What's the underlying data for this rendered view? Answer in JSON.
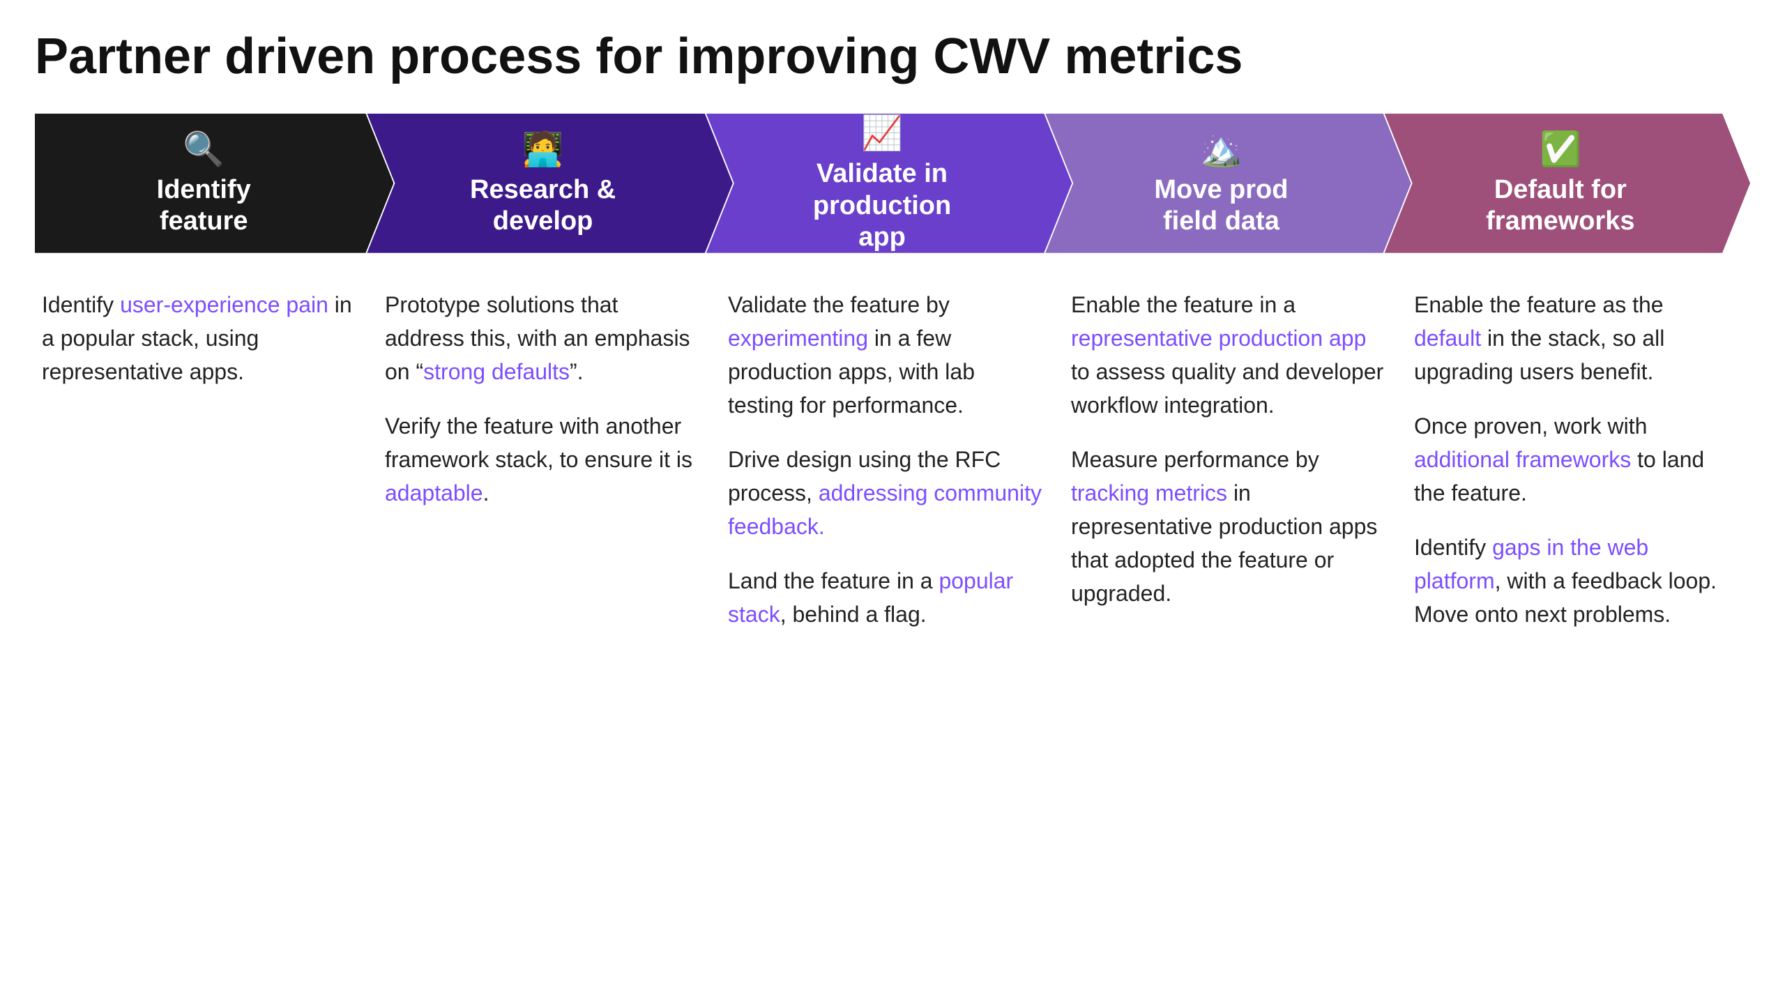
{
  "page": {
    "title": "Partner driven process for improving CWV metrics"
  },
  "arrows": [
    {
      "id": "identify",
      "icon": "🔍",
      "title": "Identify\nfeature",
      "bg": "#1a1a1a"
    },
    {
      "id": "research",
      "icon": "🧑‍💻",
      "title": "Research &\ndevelop",
      "bg": "#3d1a8a"
    },
    {
      "id": "validate",
      "icon": "📈",
      "title": "Validate in\nproduction\napp",
      "bg": "#6a3fcb"
    },
    {
      "id": "move",
      "icon": "🏔️",
      "title": "Move prod\nfield data",
      "bg": "#8b6bbf"
    },
    {
      "id": "default",
      "icon": "✅",
      "title": "Default for\nframeworks",
      "bg": "#9e4f7a"
    }
  ],
  "columns": [
    {
      "id": "identify",
      "paragraphs": [
        {
          "parts": [
            {
              "text": "Identify ",
              "type": "normal"
            },
            {
              "text": "user-experience pain",
              "type": "link"
            },
            {
              "text": " in a popular stack, using representative apps.",
              "type": "normal"
            }
          ]
        }
      ]
    },
    {
      "id": "research",
      "paragraphs": [
        {
          "parts": [
            {
              "text": "Prototype solutions that address this, with an emphasis on “",
              "type": "normal"
            },
            {
              "text": "strong defaults",
              "type": "link"
            },
            {
              "text": "”.",
              "type": "normal"
            }
          ]
        },
        {
          "parts": [
            {
              "text": "Verify the feature with another framework stack, to ensure it is ",
              "type": "normal"
            },
            {
              "text": "adaptable",
              "type": "link"
            },
            {
              "text": ".",
              "type": "normal"
            }
          ]
        }
      ]
    },
    {
      "id": "validate",
      "paragraphs": [
        {
          "parts": [
            {
              "text": "Validate the feature by ",
              "type": "normal"
            },
            {
              "text": "experimenting",
              "type": "link"
            },
            {
              "text": " in a few production apps, with lab testing for performance.",
              "type": "normal"
            }
          ]
        },
        {
          "parts": [
            {
              "text": "Drive design using the RFC process, ",
              "type": "normal"
            },
            {
              "text": "addressing community feedback.",
              "type": "link"
            }
          ]
        },
        {
          "parts": [
            {
              "text": "Land the feature in a ",
              "type": "normal"
            },
            {
              "text": "popular stack",
              "type": "link"
            },
            {
              "text": ", behind a flag.",
              "type": "normal"
            }
          ]
        }
      ]
    },
    {
      "id": "move",
      "paragraphs": [
        {
          "parts": [
            {
              "text": "Enable the feature in a ",
              "type": "normal"
            },
            {
              "text": "representative production app",
              "type": "link"
            },
            {
              "text": " to assess quality and developer workflow integration.",
              "type": "normal"
            }
          ]
        },
        {
          "parts": [
            {
              "text": "Measure performance by ",
              "type": "normal"
            },
            {
              "text": "tracking metrics",
              "type": "link"
            },
            {
              "text": " in representative production apps that adopted the feature or upgraded.",
              "type": "normal"
            }
          ]
        }
      ]
    },
    {
      "id": "default",
      "paragraphs": [
        {
          "parts": [
            {
              "text": "Enable the feature as the ",
              "type": "normal"
            },
            {
              "text": "default",
              "type": "link"
            },
            {
              "text": " in the stack, so all upgrading users benefit.",
              "type": "normal"
            }
          ]
        },
        {
          "parts": [
            {
              "text": "Once proven, work with ",
              "type": "normal"
            },
            {
              "text": "additional frameworks",
              "type": "link"
            },
            {
              "text": " to land the feature.",
              "type": "normal"
            }
          ]
        },
        {
          "parts": [
            {
              "text": "Identify ",
              "type": "normal"
            },
            {
              "text": "gaps in the web platform",
              "type": "link"
            },
            {
              "text": ", with a feedback loop. Move onto next problems.",
              "type": "normal"
            }
          ]
        }
      ]
    }
  ]
}
